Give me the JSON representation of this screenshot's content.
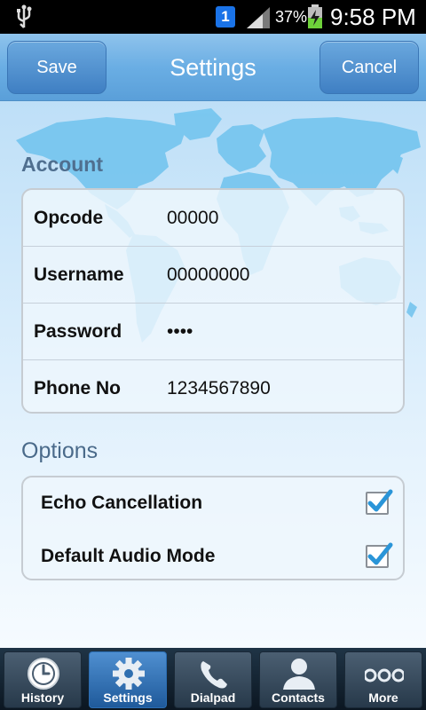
{
  "status_bar": {
    "notification_count": "1",
    "battery_percent": "37%",
    "time": "9:58 PM",
    "icons": [
      "usb-icon",
      "notification-icon",
      "signal-icon",
      "battery-charging-icon"
    ]
  },
  "header": {
    "title": "Settings",
    "save_label": "Save",
    "cancel_label": "Cancel"
  },
  "account": {
    "section_title": "Account",
    "fields": [
      {
        "label": "Opcode",
        "value": "00000"
      },
      {
        "label": "Username",
        "value": "00000000"
      },
      {
        "label": "Password",
        "value": "••••"
      },
      {
        "label": "Phone No",
        "value": "1234567890"
      }
    ]
  },
  "options": {
    "section_title": "Options",
    "items": [
      {
        "label": "Echo Cancellation",
        "checked": true
      },
      {
        "label": "Default Audio Mode",
        "checked": true
      }
    ]
  },
  "tabs": [
    {
      "label": "History",
      "icon": "clock-icon",
      "active": false
    },
    {
      "label": "Settings",
      "icon": "gear-icon",
      "active": true
    },
    {
      "label": "Dialpad",
      "icon": "phone-icon",
      "active": false
    },
    {
      "label": "Contacts",
      "icon": "person-icon",
      "active": false
    },
    {
      "label": "More",
      "icon": "more-icon",
      "active": false
    }
  ],
  "colors": {
    "header_blue": "#5a9fd9",
    "active_tab": "#1f5a9b",
    "map_blue": "#6fc3ee",
    "check_blue": "#2a95d8"
  }
}
